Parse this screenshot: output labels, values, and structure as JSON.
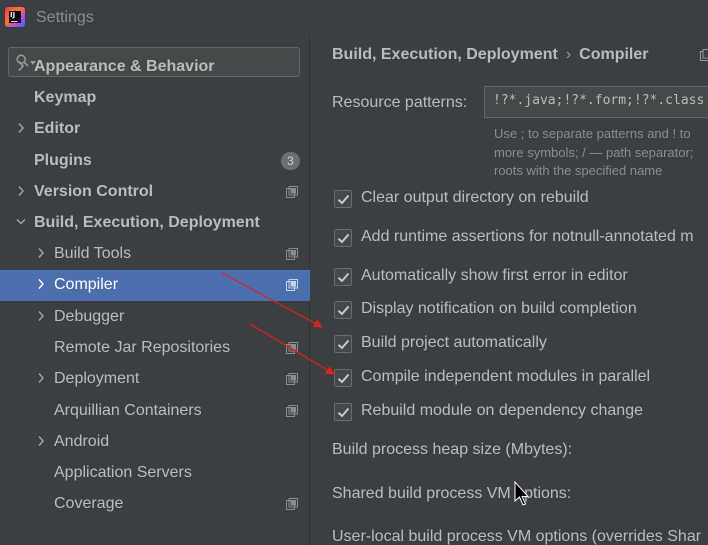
{
  "window": {
    "title": "Settings",
    "icon": "intellij-idea-logo-icon"
  },
  "search": {
    "placeholder": "",
    "value": ""
  },
  "sidebar": {
    "items": [
      {
        "label": "Appearance & Behavior",
        "expandable": true,
        "expanded": false
      },
      {
        "label": "Keymap",
        "expandable": false
      },
      {
        "label": "Editor",
        "expandable": true,
        "expanded": false
      },
      {
        "label": "Plugins",
        "expandable": false,
        "badge": "3"
      },
      {
        "label": "Version Control",
        "expandable": true,
        "expanded": false,
        "project_icon": true
      },
      {
        "label": "Build, Execution, Deployment",
        "expandable": true,
        "expanded": true
      },
      {
        "label": "Build Tools",
        "expandable": true,
        "expanded": false,
        "project_icon": true
      },
      {
        "label": "Compiler",
        "expandable": true,
        "expanded": false,
        "project_icon": true,
        "selected": true
      },
      {
        "label": "Debugger",
        "expandable": true,
        "expanded": false
      },
      {
        "label": "Remote Jar Repositories",
        "expandable": false,
        "project_icon": true
      },
      {
        "label": "Deployment",
        "expandable": true,
        "expanded": false,
        "project_icon": true
      },
      {
        "label": "Arquillian Containers",
        "expandable": false,
        "project_icon": true
      },
      {
        "label": "Android",
        "expandable": true,
        "expanded": false
      },
      {
        "label": "Application Servers",
        "expandable": false
      },
      {
        "label": "Coverage",
        "expandable": false,
        "project_icon": true
      }
    ]
  },
  "main": {
    "breadcrumb": {
      "parent": "Build, Execution, Deployment",
      "separator": "›",
      "current": "Compiler"
    },
    "resource_patterns": {
      "label": "Resource patterns:",
      "value": "!?*.java;!?*.form;!?*.class",
      "hint_lines": [
        "Use ; to separate patterns and ! to",
        "more symbols; / — path separator;",
        "roots with the specified name"
      ]
    },
    "checkboxes": [
      {
        "label": "Clear output directory on rebuild",
        "checked": true
      },
      {
        "label": "Add runtime assertions for notnull-annotated m",
        "checked": true
      },
      {
        "label": "Automatically show first error in editor",
        "checked": true
      },
      {
        "label": "Display notification on build completion",
        "checked": true
      },
      {
        "label": "Build project automatically",
        "checked": true
      },
      {
        "label": "Compile independent modules in parallel",
        "checked": true
      },
      {
        "label": "Rebuild module on dependency change",
        "checked": true
      }
    ],
    "fields": {
      "heap_size_label": "Build process heap size (Mbytes):",
      "shared_vm_label": "Shared build process VM options:",
      "user_vm_label": "User-local build process VM options (overrides Shar"
    }
  },
  "colors": {
    "background": "#3c3f41",
    "selection": "#4b6eaf",
    "text": "#bbbbbb",
    "annotation_arrow": "#e0201c"
  }
}
